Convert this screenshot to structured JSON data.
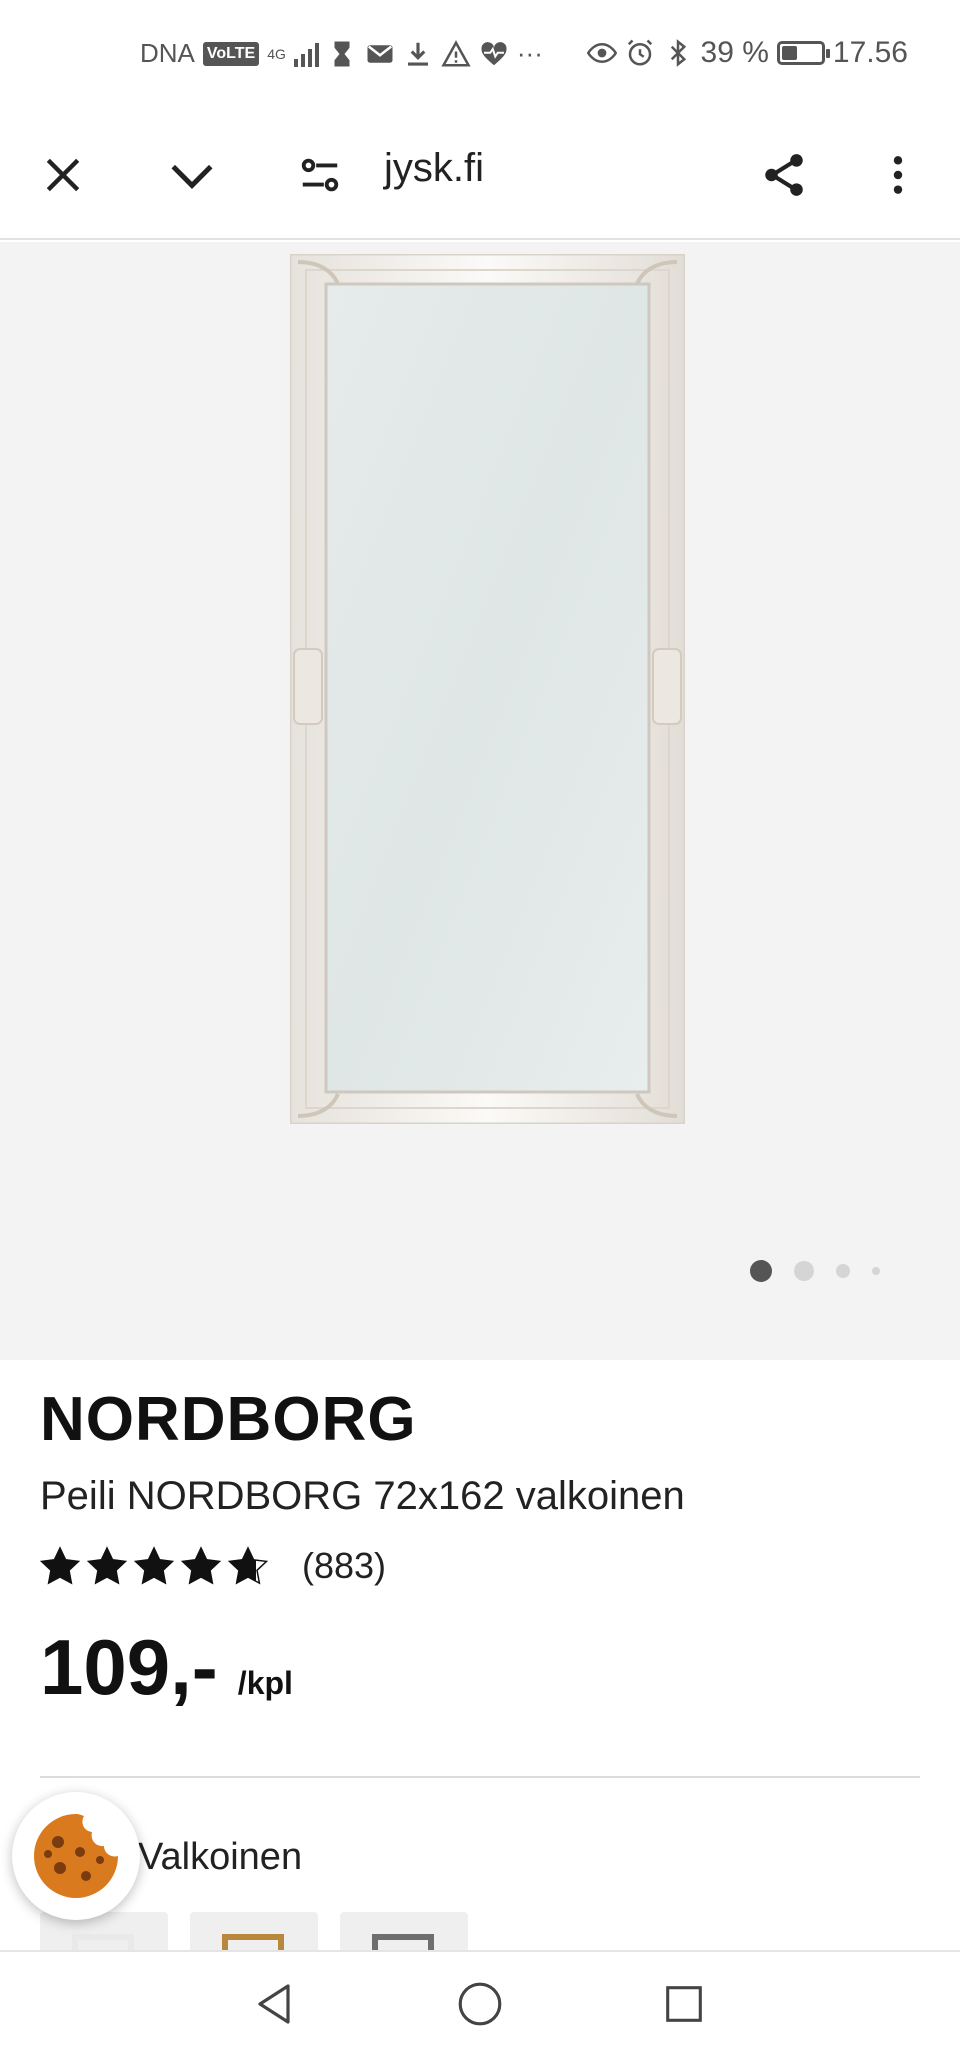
{
  "status_bar": {
    "carrier": "DNA",
    "volte": "VoLTE",
    "network": "4G",
    "signal_level": 4,
    "battery_percent": "39 %",
    "battery_level": 0.39,
    "time": "17.56",
    "ellipsis": "···",
    "icons_left": [
      "hourglass-icon",
      "mail-icon",
      "download-icon",
      "warning-icon",
      "heart-pulse-icon"
    ],
    "icons_right": [
      "eye-icon",
      "alarm-icon",
      "bluetooth-icon"
    ]
  },
  "toolbar": {
    "url": "jysk.fi",
    "icons": [
      "close-icon",
      "chevron-down-icon",
      "site-settings-icon",
      "share-icon",
      "more-vert-icon"
    ]
  },
  "gallery": {
    "image_alt": "NORDBORG white framed mirror",
    "slide_count": 4,
    "active_slide": 1
  },
  "product": {
    "brand": "NORDBORG",
    "name": "Peili NORDBORG 72x162 valkoinen",
    "rating": 4.7,
    "rating_max": 5,
    "review_count": "(883)",
    "price": "109,-",
    "unit": "/kpl",
    "color_label": "Valkoinen",
    "swatches": [
      {
        "name": "white",
        "color": "#e9e9e9"
      },
      {
        "name": "gold",
        "color": "#b8893c"
      },
      {
        "name": "grey",
        "color": "#6e6e6e"
      }
    ]
  },
  "navbar": {
    "icons": [
      "back-icon",
      "home-icon",
      "recents-icon"
    ]
  },
  "colors": {
    "gallery_bg": "#f3f3f3",
    "text": "#111111",
    "cookie": "#d97a1e"
  }
}
